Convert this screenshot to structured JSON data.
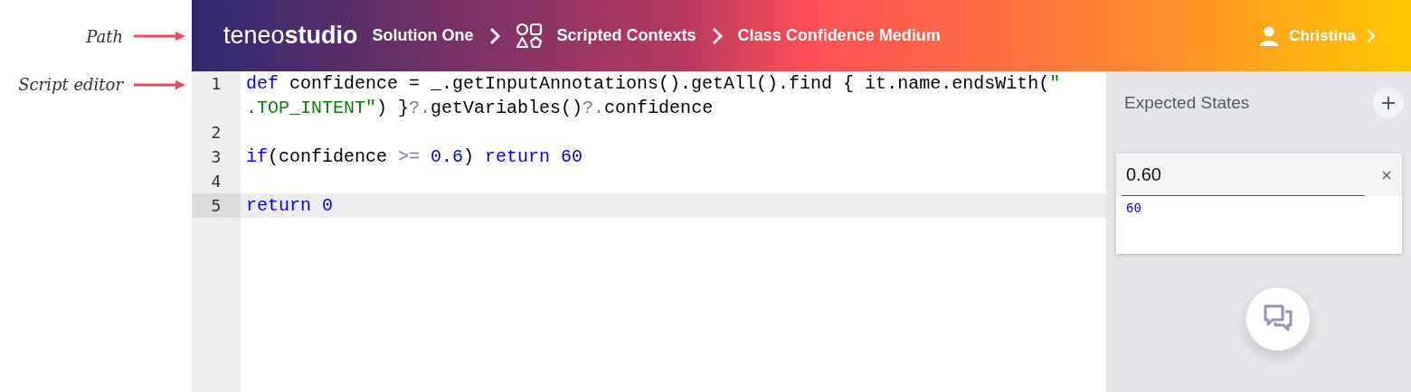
{
  "annotations": [
    {
      "label": "Path"
    },
    {
      "label": "Script editor"
    }
  ],
  "header": {
    "logo": {
      "light": "teneo",
      "bold": "studio"
    },
    "breadcrumbs": [
      {
        "label": "Solution One",
        "kind": "plain"
      },
      {
        "label": "Scripted Contexts",
        "kind": "with_icon"
      },
      {
        "label": "Class Confidence Medium",
        "kind": "plain"
      }
    ],
    "user": {
      "name": "Christina"
    }
  },
  "editor": {
    "lines": [
      {
        "number": "1",
        "current": false,
        "rows": [
          {
            "tokens": [
              {
                "kind": "keyword",
                "text": "def"
              },
              {
                "kind": "plain",
                "text": " confidence = _.getInputAnnotations().getAll().find { it.name.endsWith("
              },
              {
                "kind": "string",
                "text": "\""
              }
            ]
          },
          {
            "tokens": [
              {
                "kind": "string",
                "text": ".TOP_INTENT\""
              },
              {
                "kind": "plain",
                "text": ") }"
              },
              {
                "kind": "operator",
                "text": "?."
              },
              {
                "kind": "plain",
                "text": "getVariables()"
              },
              {
                "kind": "operator",
                "text": "?."
              },
              {
                "kind": "plain",
                "text": "confidence"
              }
            ]
          }
        ]
      },
      {
        "number": "2",
        "current": false,
        "rows": [
          {}
        ]
      },
      {
        "number": "3",
        "current": false,
        "rows": [
          {
            "tokens": [
              {
                "kind": "keyword",
                "text": "if"
              },
              {
                "kind": "plain",
                "text": "(confidence "
              },
              {
                "kind": "operator",
                "text": ">="
              },
              {
                "kind": "number",
                "text": " 0.6"
              },
              {
                "kind": "plain",
                "text": ") "
              },
              {
                "kind": "keyword",
                "text": "return"
              },
              {
                "kind": "number",
                "text": " 60"
              }
            ]
          }
        ]
      },
      {
        "number": "4",
        "current": false,
        "rows": [
          {}
        ]
      },
      {
        "number": "5",
        "current": true,
        "rows": [
          {
            "tokens": [
              {
                "kind": "keyword",
                "text": "return"
              },
              {
                "kind": "number",
                "text": " 0"
              }
            ]
          }
        ]
      }
    ]
  },
  "expected_states": {
    "title": "Expected States",
    "items": [
      {
        "value": "0.60",
        "script": "60"
      }
    ]
  }
}
